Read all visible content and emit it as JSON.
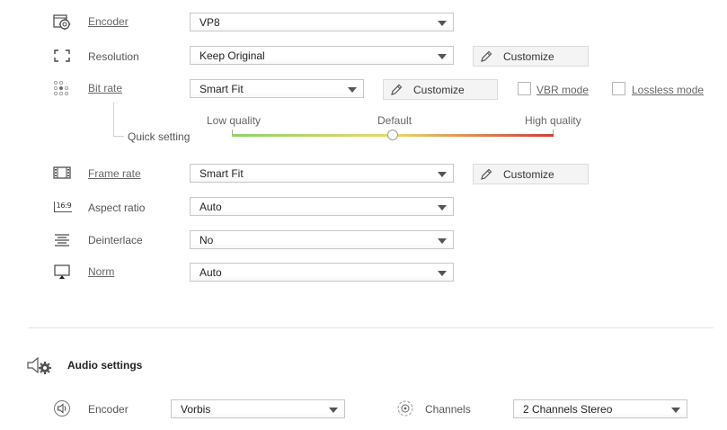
{
  "video": {
    "encoder": {
      "label": "Encoder",
      "value": "VP8",
      "icon": "encoder-gear-icon"
    },
    "resolution": {
      "label": "Resolution",
      "value": "Keep Original",
      "customize_label": "Customize",
      "icon": "resolution-frame-icon"
    },
    "bit_rate": {
      "label": "Bit rate",
      "value": "Smart Fit",
      "customize_label": "Customize",
      "vbr_label": "VBR mode",
      "vbr_checked": false,
      "lossless_label": "Lossless mode",
      "lossless_checked": false,
      "icon": "bitrate-dots-icon"
    },
    "quick_setting": {
      "label": "Quick setting",
      "low_label": "Low quality",
      "default_label": "Default",
      "high_label": "High quality",
      "level": 0.5
    },
    "frame_rate": {
      "label": "Frame rate",
      "value": "Smart Fit",
      "customize_label": "Customize",
      "icon": "film-icon"
    },
    "aspect_ratio": {
      "label": "Aspect ratio",
      "value": "Auto",
      "icon_text": "16:9"
    },
    "deinterlace": {
      "label": "Deinterlace",
      "value": "No",
      "icon": "deinterlace-lines-icon"
    },
    "norm": {
      "label": "Norm",
      "value": "Auto",
      "icon": "monitor-icon"
    }
  },
  "audio": {
    "section_title": "Audio settings",
    "encoder": {
      "label": "Encoder",
      "value": "Vorbis",
      "icon": "speaker-icon"
    },
    "channels": {
      "label": "Channels",
      "value": "2 Channels Stereo",
      "icon": "channels-icon"
    }
  },
  "colors": {
    "slider_low": "#8fd16a",
    "slider_mid": "#e8d96a",
    "slider_high": "#d23c3c"
  }
}
